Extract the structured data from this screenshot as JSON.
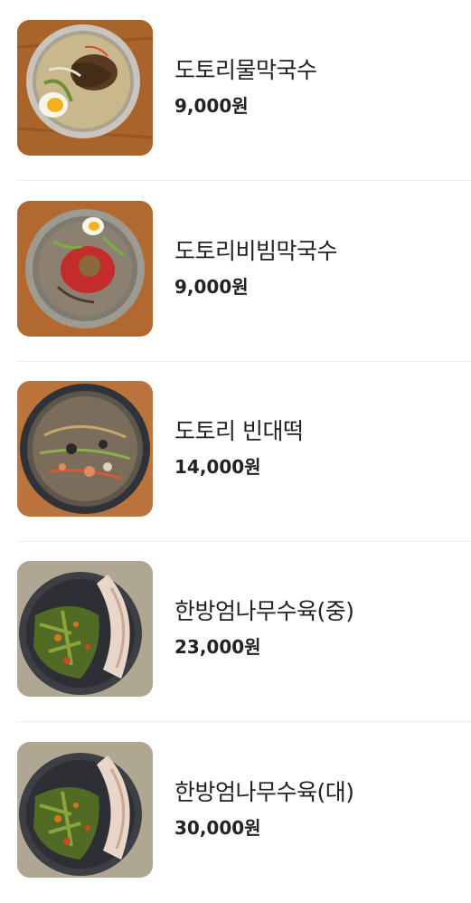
{
  "menu": {
    "items": [
      {
        "name": "도토리물막국수",
        "price": "9,000원",
        "image": "cold-buckwheat-noodle-soup-photo"
      },
      {
        "name": "도토리비빔막국수",
        "price": "9,000원",
        "image": "spicy-mixed-buckwheat-noodle-photo"
      },
      {
        "name": "도토리 빈대떡",
        "price": "14,000원",
        "image": "mung-bean-pancake-photo"
      },
      {
        "name": "한방엄나무수육(중)",
        "price": "23,000원",
        "image": "boiled-pork-with-greens-photo"
      },
      {
        "name": "한방엄나무수육(대)",
        "price": "30,000원",
        "image": "boiled-pork-with-greens-photo"
      }
    ]
  }
}
